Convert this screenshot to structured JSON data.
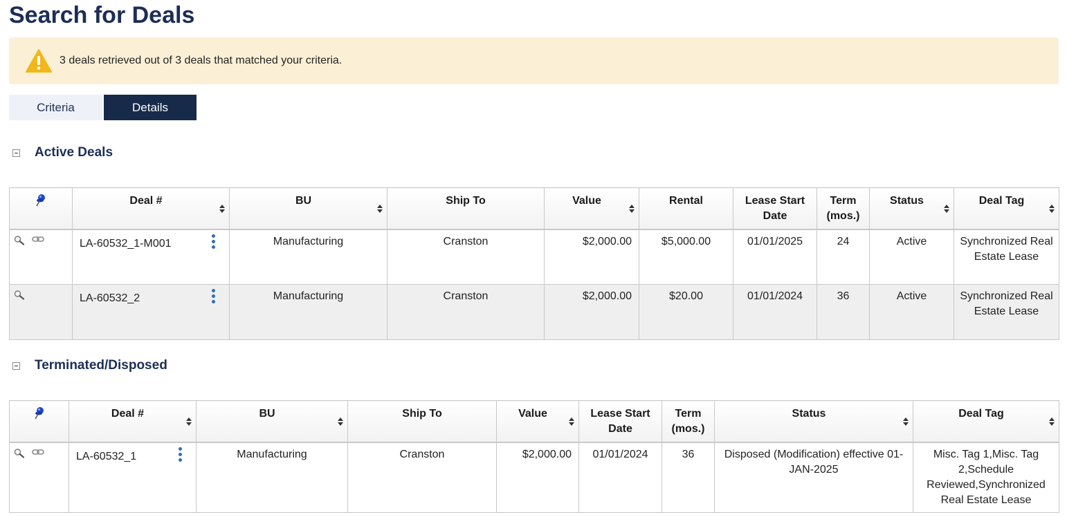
{
  "page": {
    "title": "Search for Deals"
  },
  "alert": {
    "message": "3 deals retrieved out of 3 deals that matched your criteria."
  },
  "tabs": [
    {
      "label": "Criteria",
      "active": false
    },
    {
      "label": "Details",
      "active": true
    }
  ],
  "active_deals": {
    "title": "Active Deals",
    "columns": [
      "Deal #",
      "BU",
      "Ship To",
      "Value",
      "Rental",
      "Lease Start Date",
      "Term (mos.)",
      "Status",
      "Deal Tag"
    ],
    "rows": [
      {
        "deal": "LA-60532_1-M001",
        "bu": "Manufacturing",
        "ship_to": "Cranston",
        "value": "$2,000.00",
        "rental": "$5,000.00",
        "lease_start": "01/01/2025",
        "term": "24",
        "status": "Active",
        "tag": "Synchronized Real Estate Lease"
      },
      {
        "deal": "LA-60532_2",
        "bu": "Manufacturing",
        "ship_to": "Cranston",
        "value": "$2,000.00",
        "rental": "$20.00",
        "lease_start": "01/01/2024",
        "term": "36",
        "status": "Active",
        "tag": "Synchronized Real Estate Lease"
      }
    ]
  },
  "terminated": {
    "title": "Terminated/Disposed",
    "columns": [
      "Deal #",
      "BU",
      "Ship To",
      "Value",
      "Lease Start Date",
      "Term (mos.)",
      "Status",
      "Deal Tag"
    ],
    "rows": [
      {
        "deal": "LA-60532_1",
        "bu": "Manufacturing",
        "ship_to": "Cranston",
        "value": "$2,000.00",
        "lease_start": "01/01/2024",
        "term": "36",
        "status": "Disposed (Modification) effective 01-JAN-2025",
        "tag": "Misc. Tag 1,Misc. Tag 2,Schedule Reviewed,Synchronized Real Estate Lease"
      }
    ]
  },
  "colors": {
    "title": "#1d2e55",
    "tab_active": "#172a4a",
    "tab_inactive": "#eef2f8",
    "alert_bg": "#fbf0d6",
    "warning": "#f2b718",
    "kebab": "#2f6fb6",
    "pin": "#2048c8"
  },
  "icons": {
    "alert": "warning-icon",
    "pin": "pushpin-icon",
    "view": "magnifier-icon",
    "link": "chain-link-icon",
    "menu": "kebab-menu-icon",
    "collapse": "collapse-minus-icon"
  }
}
